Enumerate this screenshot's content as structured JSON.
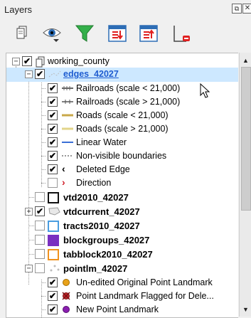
{
  "panel": {
    "title": "Layers",
    "float_icon": "⧉",
    "close_icon": "✕"
  },
  "toolbar": {
    "buttons": [
      {
        "name": "add-group-icon"
      },
      {
        "name": "visibility-eye-icon"
      },
      {
        "name": "filter-legend-icon"
      },
      {
        "name": "expand-all-icon"
      },
      {
        "name": "collapse-all-icon"
      },
      {
        "name": "remove-layer-icon"
      }
    ]
  },
  "tree": {
    "group": {
      "label": "working_county",
      "expanded_sign": "−"
    },
    "layers": [
      {
        "id": "edges",
        "label": "edges_42027",
        "selected": true
      },
      {
        "id": "railroads_lt",
        "label": "Railroads (scale < 21,000)"
      },
      {
        "id": "railroads_gt",
        "label": "Railroads (scale > 21,000)"
      },
      {
        "id": "roads_lt",
        "label": "Roads (scale < 21,000)"
      },
      {
        "id": "roads_gt",
        "label": "Roads (scale > 21,000)"
      },
      {
        "id": "linear_water",
        "label": "Linear Water"
      },
      {
        "id": "nonvisible",
        "label": "Non-visible boundaries"
      },
      {
        "id": "deleted_edge",
        "label": "Deleted Edge",
        "glyph": "‹"
      },
      {
        "id": "direction",
        "label": "Direction",
        "glyph": "›"
      },
      {
        "id": "vtd2010",
        "label": "vtd2010_42027"
      },
      {
        "id": "vtdcurrent",
        "label": "vtdcurrent_42027",
        "expanded_sign": "+"
      },
      {
        "id": "tracts2010",
        "label": "tracts2010_42027"
      },
      {
        "id": "blockgroups",
        "label": "blockgroups_42027"
      },
      {
        "id": "tabblock2010",
        "label": "tabblock2010_42027"
      },
      {
        "id": "pointlm",
        "label": "pointlm_42027",
        "expanded_sign": "−"
      },
      {
        "id": "unedited_plm",
        "label": "Un-edited Original Point Landmark"
      },
      {
        "id": "flagged_plm",
        "label": "Point Landmark Flagged for Dele..."
      },
      {
        "id": "new_plm",
        "label": "New Point Landmark"
      }
    ],
    "check_mark": "✔"
  },
  "colors": {
    "selection": "#cde8ff",
    "selected_text": "#1e5cd0",
    "linear_water": "#3b6fd6",
    "tracts": "#4a9de0",
    "blockgroups": "#7a2fc0",
    "tabblock": "#f0921e",
    "unedited_point": "#e8a21a",
    "new_point": "#8a1fb0",
    "flag": "#c0282d",
    "direction": "#d0202a"
  }
}
